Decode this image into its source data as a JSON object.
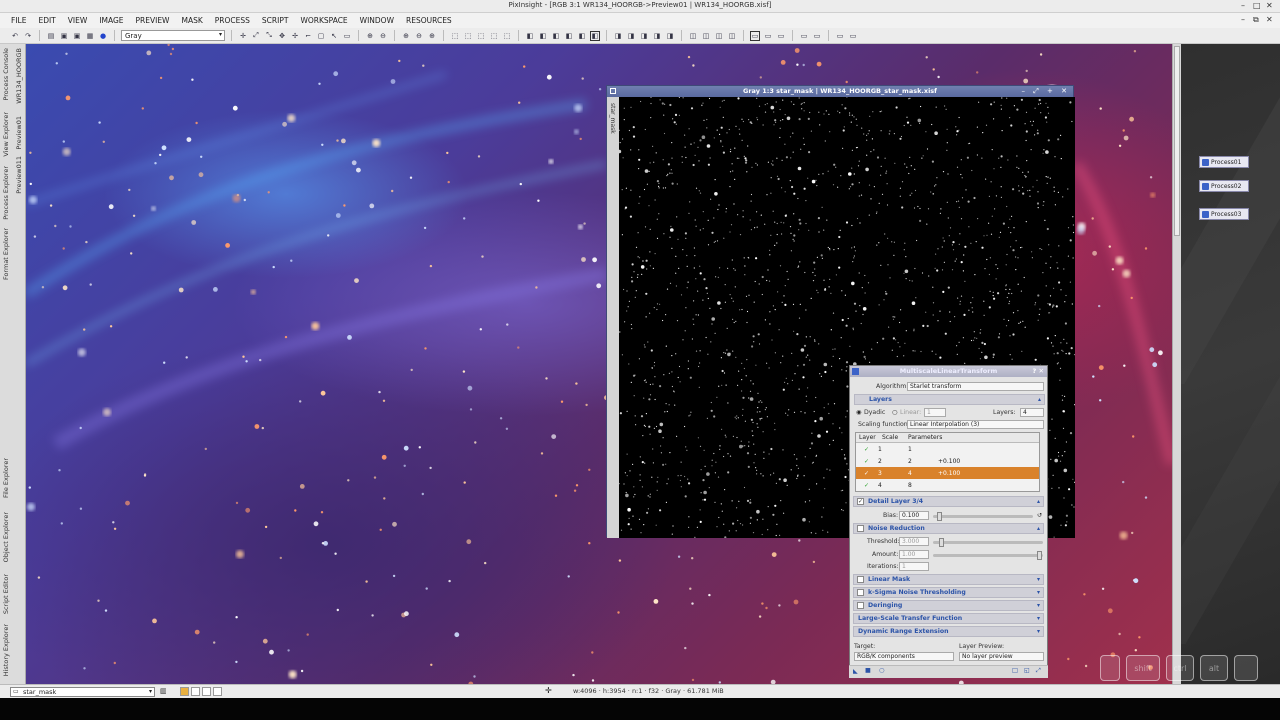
{
  "window": {
    "title": "PixInsight - [RGB 3:1 WR134_HOORGB->Preview01 | WR134_HOORGB.xisf]"
  },
  "menu": [
    "FILE",
    "EDIT",
    "VIEW",
    "IMAGE",
    "PREVIEW",
    "MASK",
    "PROCESS",
    "SCRIPT",
    "WORKSPACE",
    "WINDOW",
    "RESOURCES"
  ],
  "toolbar": {
    "view_mode": "Gray"
  },
  "left_tabs": {
    "outer": [
      "Process Console",
      "View Explorer",
      "Process Explorer",
      "Format Explorer",
      "File Explorer",
      "Object Explorer",
      "Script Editor",
      "History Explorer"
    ],
    "inner": [
      "WR134_HOORGB",
      "Preview01",
      "Preview011"
    ]
  },
  "star_window": {
    "title": "Gray 1:3 star_mask | WR134_HOORGB_star_mask.xisf",
    "side_label": "star_mask"
  },
  "process_icons": [
    "Process01",
    "Process02",
    "Process03"
  ],
  "mlt": {
    "title": "MultiscaleLinearTransform",
    "algorithm_label": "Algorithm:",
    "algorithm_value": "Starlet transform",
    "layers_section": "Layers",
    "dyadic_label": "Dyadic",
    "linear_label": "Linear:",
    "linear_value": "1",
    "layers_label": "Layers:",
    "layers_value": "4",
    "scaling_label": "Scaling function:",
    "scaling_value": "Linear Interpolation (3)",
    "table_headers": [
      "Layer",
      "Scale",
      "Parameters"
    ],
    "table_rows": [
      {
        "layer": "1",
        "scale": "1",
        "params": ""
      },
      {
        "layer": "2",
        "scale": "2",
        "params": "+0.100"
      },
      {
        "layer": "3",
        "scale": "4",
        "params": "+0.100"
      },
      {
        "layer": "4",
        "scale": "8",
        "params": ""
      }
    ],
    "detail_section": "Detail Layer 3/4",
    "bias_label": "Bias:",
    "bias_value": "0.100",
    "noise_section": "Noise Reduction",
    "threshold_label": "Threshold:",
    "threshold_value": "3.000",
    "amount_label": "Amount:",
    "amount_value": "1.00",
    "iterations_label": "Iterations:",
    "iterations_value": "1",
    "sections": [
      "Linear Mask",
      "k-Sigma Noise Thresholding",
      "Deringing",
      "Large-Scale Transfer Function",
      "Dynamic Range Extension"
    ],
    "target_label": "Target:",
    "target_value": "RGB/K components",
    "layer_preview_label": "Layer Preview:",
    "layer_preview_value": "No layer preview"
  },
  "status": {
    "view_selector": "star_mask",
    "info": "w:4096 · h:3954 · n:1 · f32 · Gray · 61.781 MiB"
  },
  "keys": [
    "shift",
    "ctrl",
    "alt"
  ]
}
